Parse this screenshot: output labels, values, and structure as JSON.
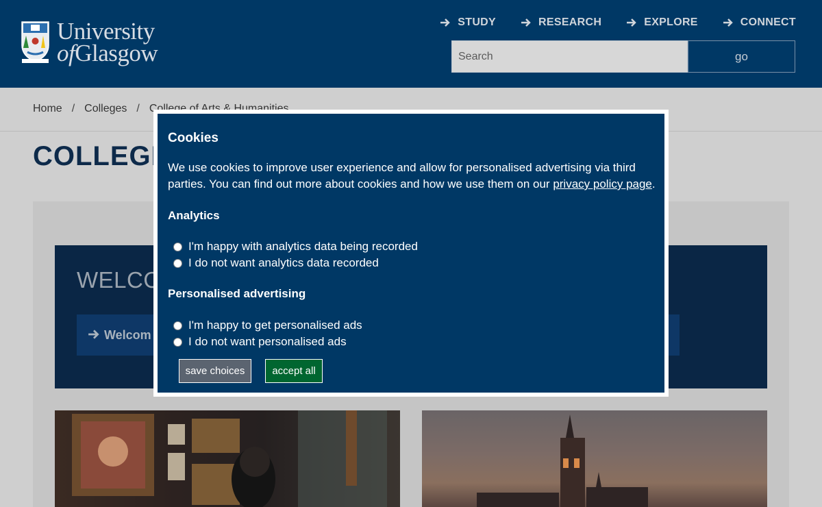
{
  "header": {
    "logo_line1": "University",
    "logo_line2_italic": "of",
    "logo_line2_rest": "Glasgow",
    "nav": [
      {
        "label": "STUDY",
        "icon": "arrow-right-icon"
      },
      {
        "label": "RESEARCH",
        "icon": "arrow-right-icon"
      },
      {
        "label": "EXPLORE",
        "icon": "arrow-right-icon"
      },
      {
        "label": "CONNECT",
        "icon": "arrow-right-icon"
      }
    ],
    "search": {
      "placeholder": "Search",
      "button": "go"
    }
  },
  "breadcrumb": {
    "items": [
      "Home",
      "Colleges",
      "College of Arts & Humanities"
    ],
    "separator": "/"
  },
  "page": {
    "title": "COLLEGE",
    "welcome_title": "WELCO",
    "welcome_link": "Welcom"
  },
  "cookie_modal": {
    "title": "Cookies",
    "text_before_link": "We use cookies to improve user experience and allow for personalised advertising via third parties. You can find out more about cookies and how we use them on our ",
    "link_text": "privacy policy page",
    "text_after_link": ".",
    "analytics": {
      "title": "Analytics",
      "options": [
        "I'm happy with analytics data being recorded",
        "I do not want analytics data recorded"
      ]
    },
    "advertising": {
      "title": "Personalised advertising",
      "options": [
        "I'm happy to get personalised ads",
        "I do not want personalised ads"
      ]
    },
    "buttons": {
      "save": "save choices",
      "accept": "accept all"
    }
  },
  "colors": {
    "brand_navy": "#003865",
    "accept_green": "#006630",
    "save_grey": "#5b6470"
  }
}
